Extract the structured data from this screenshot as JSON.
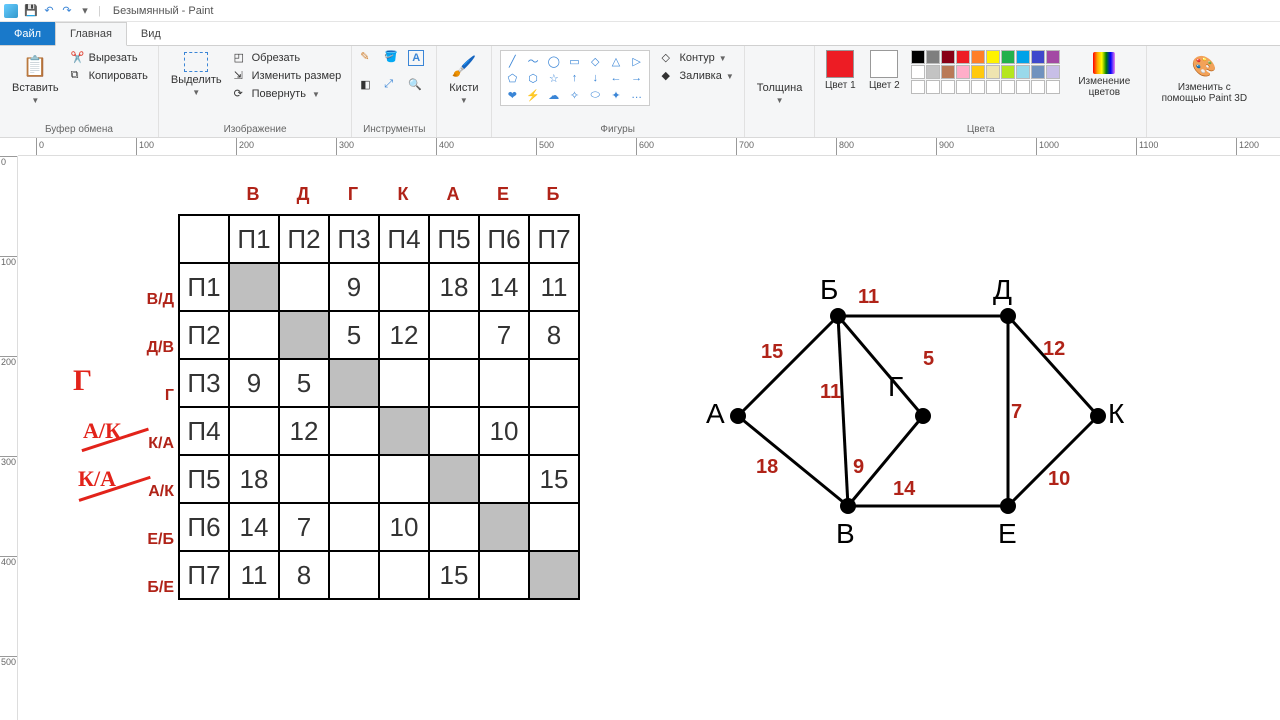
{
  "window": {
    "title": "Безымянный - Paint"
  },
  "tabs": {
    "file": "Файл",
    "home": "Главная",
    "view": "Вид"
  },
  "ribbon": {
    "clipboard": {
      "label": "Буфер обмена",
      "paste": "Вставить",
      "cut": "Вырезать",
      "copy": "Копировать"
    },
    "image": {
      "label": "Изображение",
      "select": "Выделить",
      "crop": "Обрезать",
      "resize": "Изменить размер",
      "rotate": "Повернуть"
    },
    "tools": {
      "label": "Инструменты"
    },
    "brushes": {
      "label": "Кисти"
    },
    "shapes": {
      "label": "Фигуры",
      "outline": "Контур",
      "fill": "Заливка"
    },
    "thickness": {
      "label": "Толщина"
    },
    "colors": {
      "label": "Цвета",
      "c1": "Цвет 1",
      "c2": "Цвет 2",
      "edit": "Изменение цветов",
      "c1_hex": "#ed1c24",
      "c2_hex": "#ffffff",
      "palette": [
        "#000000",
        "#7f7f7f",
        "#880015",
        "#ed1c24",
        "#ff7f27",
        "#fff200",
        "#22b14c",
        "#00a2e8",
        "#3f48cc",
        "#a349a4",
        "#ffffff",
        "#c3c3c3",
        "#b97a57",
        "#ffaec9",
        "#ffc90e",
        "#efe4b0",
        "#b5e61d",
        "#99d9ea",
        "#7092be",
        "#c8bfe7",
        "#ffffff",
        "#ffffff",
        "#ffffff",
        "#ffffff",
        "#ffffff",
        "#ffffff",
        "#ffffff",
        "#ffffff",
        "#ffffff",
        "#ffffff"
      ]
    },
    "paint3d": {
      "label": "Изменить с помощью Paint 3D"
    }
  },
  "ruler_marks": [
    0,
    100,
    200,
    300,
    400,
    500,
    600,
    700,
    800,
    900,
    1000,
    1100,
    1200
  ],
  "ruler_marks_v": [
    0,
    100,
    200,
    300,
    400,
    500
  ],
  "table": {
    "top_letters": [
      "В",
      "Д",
      "Г",
      "К",
      "А",
      "Е",
      "Б"
    ],
    "headers": [
      "",
      "П1",
      "П2",
      "П3",
      "П4",
      "П5",
      "П6",
      "П7"
    ],
    "rows": [
      {
        "lab": "В/Д",
        "cells": [
          "П1",
          "@",
          "",
          "9",
          "",
          "18",
          "14",
          "11"
        ]
      },
      {
        "lab": "Д/В",
        "cells": [
          "П2",
          "",
          "@",
          "5",
          "12",
          "",
          "7",
          "8"
        ]
      },
      {
        "lab": "Г",
        "cells": [
          "П3",
          "9",
          "5",
          "@",
          "",
          "",
          "",
          ""
        ]
      },
      {
        "lab": "К/А",
        "cells": [
          "П4",
          "",
          "12",
          "",
          "@",
          "",
          "10",
          ""
        ]
      },
      {
        "lab": "А/К",
        "cells": [
          "П5",
          "18",
          "",
          "",
          "",
          "@",
          "",
          "15"
        ]
      },
      {
        "lab": "Е/Б",
        "cells": [
          "П6",
          "14",
          "7",
          "",
          "10",
          "",
          "@",
          ""
        ]
      },
      {
        "lab": "Б/Е",
        "cells": [
          "П7",
          "11",
          "8",
          "",
          "",
          "15",
          "",
          "@"
        ]
      }
    ],
    "handwriting": {
      "g": "Г",
      "ak": "А/К",
      "ka": "К/А"
    }
  },
  "graph": {
    "nodes": {
      "A": "А",
      "B": "Б",
      "V": "В",
      "G": "Г",
      "D": "Д",
      "E": "Е",
      "K": "К"
    },
    "edges": {
      "AB": "15",
      "AV": "18",
      "BV": "11",
      "BD": "11",
      "BG": "5",
      "VG": "9",
      "VE": "14",
      "DG": "7",
      "DK": "12",
      "EK": "10"
    },
    "chart_data": {
      "type": "graph",
      "vertices": [
        "А",
        "Б",
        "В",
        "Г",
        "Д",
        "Е",
        "К"
      ],
      "weighted_edges": [
        [
          "А",
          "Б",
          15
        ],
        [
          "А",
          "В",
          18
        ],
        [
          "Б",
          "В",
          11
        ],
        [
          "Б",
          "Д",
          11
        ],
        [
          "Б",
          "Г",
          5
        ],
        [
          "В",
          "Г",
          9
        ],
        [
          "В",
          "Е",
          14
        ],
        [
          "Д",
          "Г",
          7
        ],
        [
          "Д",
          "К",
          12
        ],
        [
          "Е",
          "К",
          10
        ]
      ]
    }
  }
}
